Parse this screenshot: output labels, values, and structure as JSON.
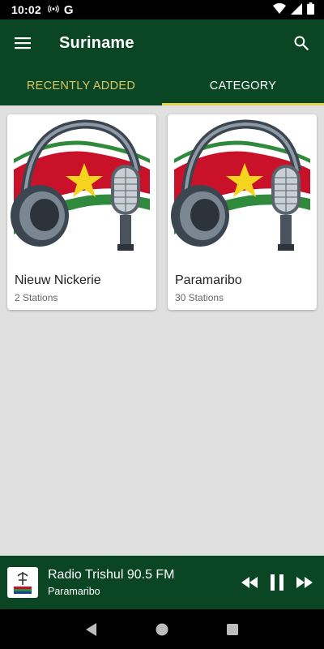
{
  "status": {
    "time": "10:02",
    "g_label": "G",
    "icons": [
      "hotspot-icon",
      "google-icon",
      "wifi-icon",
      "signal-icon",
      "battery-icon"
    ]
  },
  "appbar": {
    "title": "Suriname",
    "menu_icon": "hamburger-menu-icon",
    "search_icon": "search-icon"
  },
  "tabs": [
    {
      "label": "RECENTLY ADDED",
      "active": false
    },
    {
      "label": "CATEGORY",
      "active": true
    }
  ],
  "categories": [
    {
      "name": "Nieuw Nickerie",
      "stations": "2 Stations",
      "image": "suriname-flag-headphones-mic"
    },
    {
      "name": "Paramaribo",
      "stations": "30 Stations",
      "image": "suriname-flag-headphones-mic"
    }
  ],
  "player": {
    "title": "Radio Trishul 90.5 FM",
    "subtitle": "Paramaribo",
    "controls": [
      "rewind-icon",
      "pause-icon",
      "fast-forward-icon"
    ]
  },
  "navbar": {
    "buttons": [
      "back-icon",
      "home-icon",
      "recents-icon"
    ]
  },
  "colors": {
    "primary": "#0a4524",
    "accent": "#e3d44a",
    "tab_inactive": "#d8c868",
    "background": "#e0e0e0"
  }
}
